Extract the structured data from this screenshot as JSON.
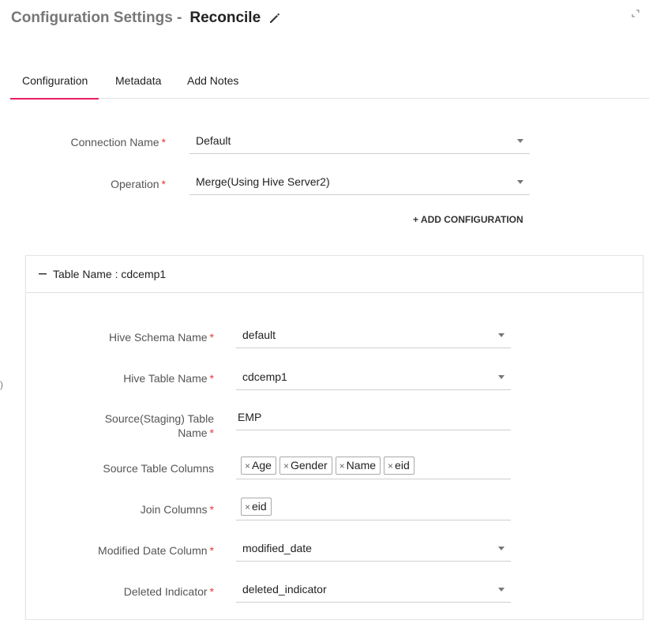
{
  "header": {
    "title_prefix": "Configuration Settings -",
    "title_name": "Reconcile"
  },
  "tabs": [
    {
      "label": "Configuration",
      "active": true
    },
    {
      "label": "Metadata",
      "active": false
    },
    {
      "label": "Add Notes",
      "active": false
    }
  ],
  "form": {
    "connection_name": {
      "label": "Connection Name",
      "value": "Default"
    },
    "operation": {
      "label": "Operation",
      "value": "Merge(Using Hive Server2)"
    },
    "add_configuration": "+ ADD CONFIGURATION"
  },
  "panel": {
    "title": "Table Name : cdcemp1",
    "hive_schema": {
      "label": "Hive Schema Name",
      "value": "default"
    },
    "hive_table": {
      "label": "Hive Table Name",
      "value": "cdcemp1"
    },
    "source_table": {
      "label_line1": "Source(Staging) Table",
      "label_line2": "Name",
      "value": "EMP"
    },
    "source_columns": {
      "label": "Source Table Columns",
      "chips": [
        "Age",
        "Gender",
        "Name",
        "eid"
      ]
    },
    "join_columns": {
      "label": "Join Columns",
      "chips": [
        "eid"
      ]
    },
    "modified_date": {
      "label": "Modified Date Column",
      "value": "modified_date"
    },
    "deleted_indicator": {
      "label": "Deleted Indicator",
      "value": "deleted_indicator"
    }
  },
  "required_mark": "*",
  "chip_remove": "×",
  "misc": {
    "left_bracket": ")"
  }
}
